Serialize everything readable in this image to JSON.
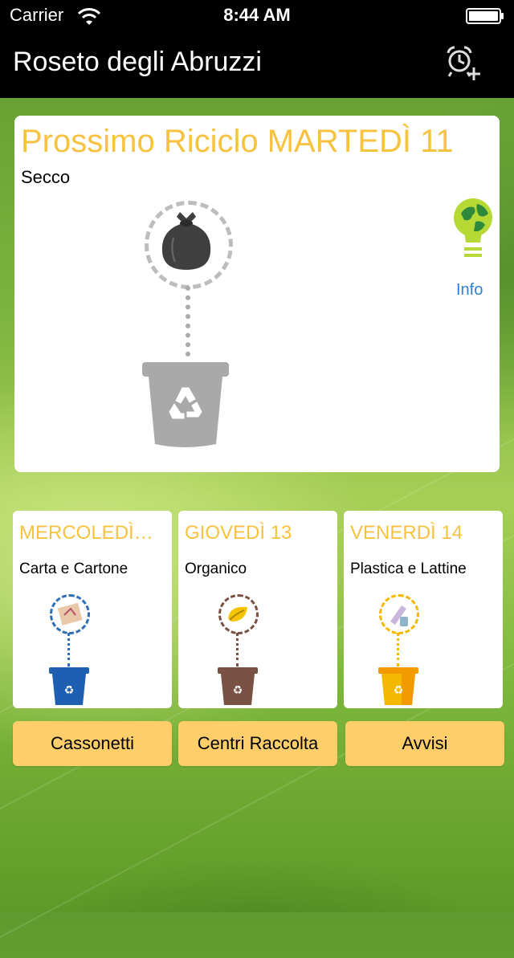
{
  "status_bar": {
    "carrier": "Carrier",
    "time": "8:44 AM"
  },
  "nav": {
    "title": "Roseto degli Abruzzi",
    "alarm_icon": "alarm-add-icon"
  },
  "next_pickup": {
    "title": "Prossimo Riciclo MARTEDÌ 11",
    "waste_type": "Secco",
    "info_label": "Info",
    "bin_color": "#a9a9a9"
  },
  "upcoming": [
    {
      "day": "MERCOLEDÌ…",
      "waste_type": "Carta e Cartone",
      "bin_color": "#1f5fb1",
      "icon": "paper-icon"
    },
    {
      "day": "GIOVEDÌ 13",
      "waste_type": "Organico",
      "bin_color": "#7a5244",
      "icon": "organic-icon"
    },
    {
      "day": "VENERDÌ 14",
      "waste_type": "Plastica e Lattine",
      "bin_color": "#f5b800",
      "icon": "plastic-icon"
    }
  ],
  "buttons": {
    "bins": "Cassonetti",
    "collection_centers": "Centri Raccolta",
    "notices": "Avvisi"
  },
  "colors": {
    "accent": "#f7c33f",
    "button_bg": "#fece6a",
    "link": "#2e80d6"
  }
}
